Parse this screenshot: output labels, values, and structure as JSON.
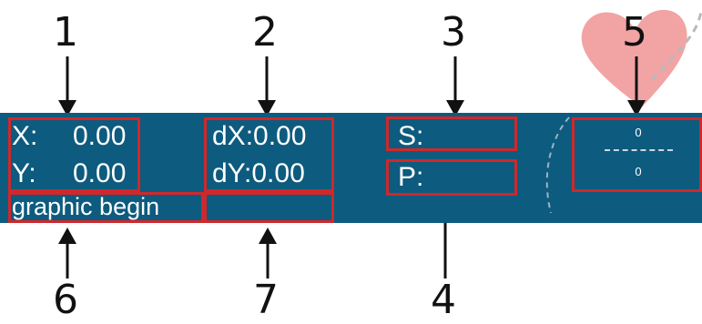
{
  "colors": {
    "statusbar_bg": "#0d5b7e",
    "highlight_box": "#d0282b",
    "status_text": "#ffffff",
    "callout_text": "#111111",
    "heart": "#f2a3a3"
  },
  "callouts": [
    "1",
    "2",
    "3",
    "4",
    "5",
    "6",
    "7"
  ],
  "statusbar": {
    "x_label": "X:",
    "x_value": "0.00",
    "y_label": "Y:",
    "y_value": "0.00",
    "dx_text": "dX:0.00",
    "dy_text": "dY:0.00",
    "s_label": "S:",
    "p_label": "P:",
    "scale_top": "0",
    "scale_bottom": "0",
    "message": "graphic begin",
    "extra_field": ""
  },
  "decoration": {
    "icon": "heart-icon"
  }
}
